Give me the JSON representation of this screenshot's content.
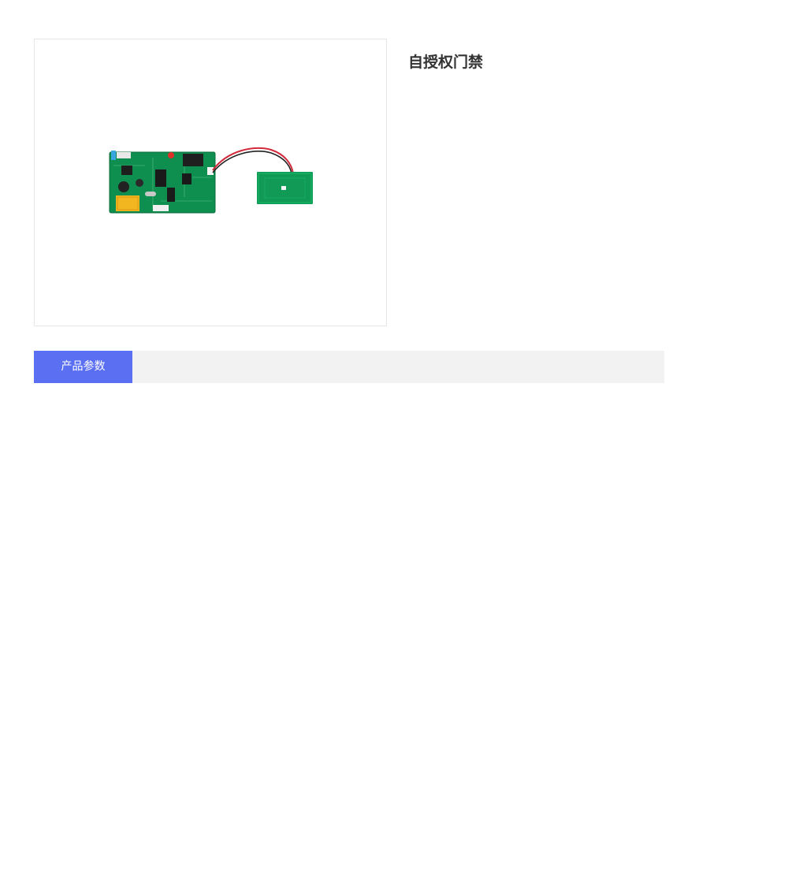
{
  "product": {
    "title": "自授权门禁",
    "image": {
      "icon": "rfid-access-control-board-image"
    }
  },
  "tabs": [
    {
      "label": "产品参数",
      "active": true
    }
  ],
  "colors": {
    "tab_active_bg": "#5b6ff2",
    "tab_bar_bg": "#f2f2f2",
    "pcb_green": "#0f8f4f",
    "title_text": "#333333"
  }
}
